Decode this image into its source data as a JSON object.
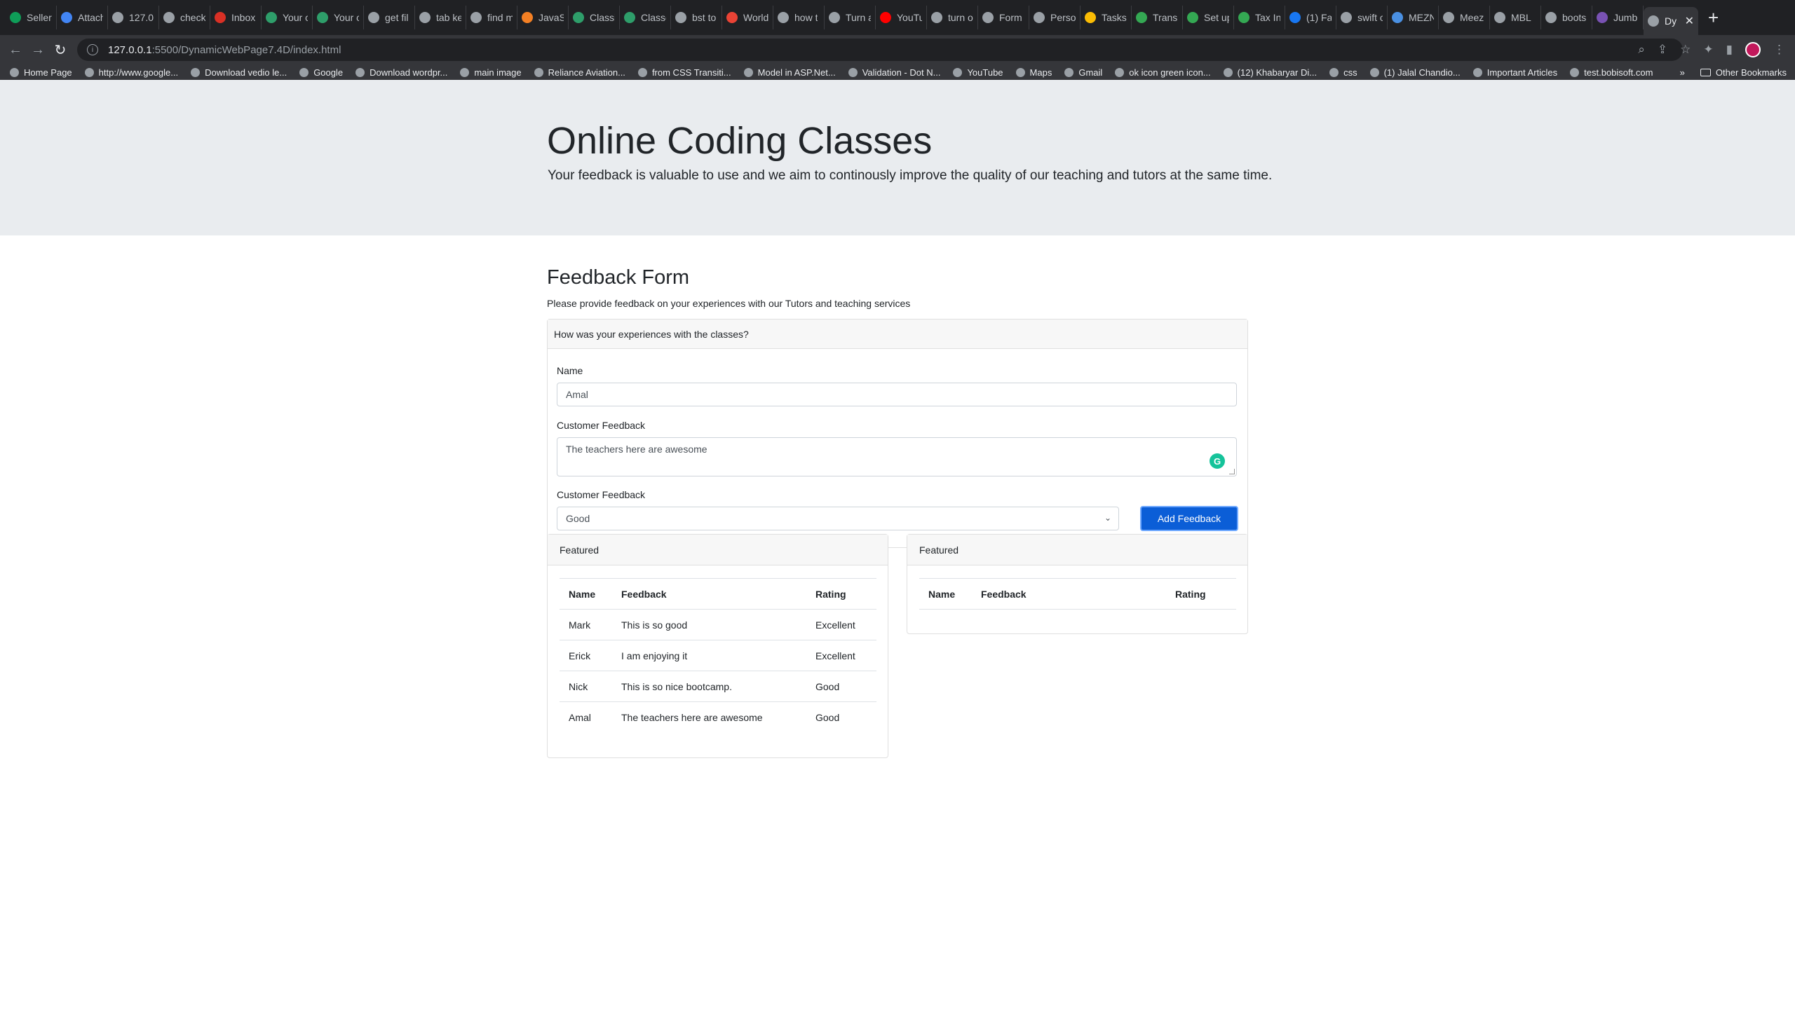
{
  "browser": {
    "tabs": [
      {
        "title": "Seller",
        "color": "#0f9d58"
      },
      {
        "title": "Attach",
        "color": "#4285f4"
      },
      {
        "title": "127.0",
        "color": "#9aa0a6"
      },
      {
        "title": "check",
        "color": "#9aa0a6"
      },
      {
        "title": "Inbox",
        "color": "#d93025"
      },
      {
        "title": "Your c",
        "color": "#2e9e6a"
      },
      {
        "title": "Your c",
        "color": "#2e9e6a"
      },
      {
        "title": "get fil",
        "color": "#9aa0a6"
      },
      {
        "title": "tab ke",
        "color": "#9aa0a6"
      },
      {
        "title": "find m",
        "color": "#9aa0a6"
      },
      {
        "title": "JavaS",
        "color": "#f48024"
      },
      {
        "title": "Classi",
        "color": "#2e9e6a"
      },
      {
        "title": "Classe",
        "color": "#2e9e6a"
      },
      {
        "title": "bst to",
        "color": "#9aa0a6"
      },
      {
        "title": "World",
        "color": "#ea4335"
      },
      {
        "title": "how t",
        "color": "#9aa0a6"
      },
      {
        "title": "Turn a",
        "color": "#9aa0a6"
      },
      {
        "title": "YouTu",
        "color": "#ff0000"
      },
      {
        "title": "turn o",
        "color": "#9aa0a6"
      },
      {
        "title": "Form",
        "color": "#9aa0a6"
      },
      {
        "title": "Perso",
        "color": "#9aa0a6"
      },
      {
        "title": "Tasks",
        "color": "#fbbc04"
      },
      {
        "title": "Trans",
        "color": "#34a853"
      },
      {
        "title": "Set up",
        "color": "#34a853"
      },
      {
        "title": "Tax In",
        "color": "#34a853"
      },
      {
        "title": "(1) Fa",
        "color": "#1877f2"
      },
      {
        "title": "swift c",
        "color": "#9aa0a6"
      },
      {
        "title": "MEZN",
        "color": "#4a90e2"
      },
      {
        "title": "Meez",
        "color": "#9aa0a6"
      },
      {
        "title": "MBL",
        "color": "#9aa0a6"
      },
      {
        "title": "boots",
        "color": "#9aa0a6"
      },
      {
        "title": "Jumb",
        "color": "#7952b3"
      }
    ],
    "active_tab": {
      "title": "Dy",
      "close": "✕"
    },
    "new_tab": "+",
    "url_host": "127.0.0.1",
    "url_path": ":5500/DynamicWebPage7.4D/index.html",
    "bookmarks": [
      "Home Page",
      "http://www.google...",
      "Download vedio le...",
      "Google",
      "Download wordpr...",
      "main image",
      "Reliance Aviation...",
      "from CSS Transiti...",
      "Model in ASP.Net...",
      "Validation - Dot N...",
      "YouTube",
      "Maps",
      "Gmail",
      "ok icon green icon...",
      "(12) Khabaryar Di...",
      "css",
      "(1) Jalal Chandio...",
      "Important Articles",
      "test.bobisoft.com"
    ],
    "bookmarks_more": "»",
    "other_bookmarks": "Other Bookmarks"
  },
  "jumbotron": {
    "title": "Online Coding Classes",
    "lead": "Your feedback is valuable to use and we aim to continously improve the quality of our teaching and tutors at the same time."
  },
  "form": {
    "title": "Feedback Form",
    "subtitle": "Please provide feedback on your experiences with our Tutors and teaching services",
    "card_header": "How was your experiences with the classes?",
    "name_label": "Name",
    "name_value": "Amal",
    "feedback_label": "Customer Feedback",
    "feedback_value": "The teachers here are awesome",
    "rating_label": "Customer Feedback",
    "rating_value": "Good",
    "button": "Add Feedback"
  },
  "tables": [
    {
      "header": "Featured",
      "columns": [
        "Name",
        "Feedback",
        "Rating"
      ],
      "rows": [
        [
          "Mark",
          "This is so good",
          "Excellent"
        ],
        [
          "Erick",
          "I am enjoying it",
          "Excellent"
        ],
        [
          "Nick",
          "This is so nice bootcamp.",
          "Good"
        ],
        [
          "Amal",
          "The teachers here are awesome",
          "Good"
        ]
      ]
    },
    {
      "header": "Featured",
      "columns": [
        "Name",
        "Feedback",
        "Rating"
      ],
      "rows": []
    }
  ]
}
